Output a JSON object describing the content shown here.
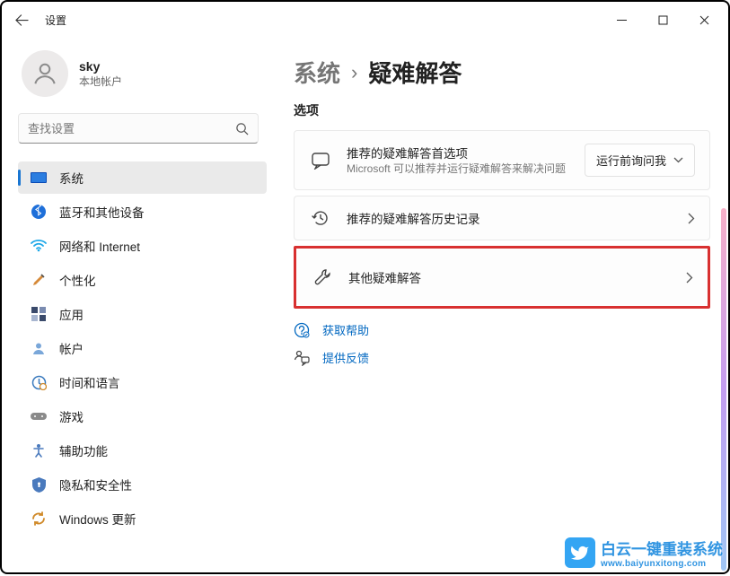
{
  "titlebar": {
    "app_name": "设置"
  },
  "user": {
    "name": "sky",
    "account": "本地帐户"
  },
  "search": {
    "placeholder": "查找设置"
  },
  "nav": {
    "items": [
      {
        "label": "系统"
      },
      {
        "label": "蓝牙和其他设备"
      },
      {
        "label": "网络和 Internet"
      },
      {
        "label": "个性化"
      },
      {
        "label": "应用"
      },
      {
        "label": "帐户"
      },
      {
        "label": "时间和语言"
      },
      {
        "label": "游戏"
      },
      {
        "label": "辅助功能"
      },
      {
        "label": "隐私和安全性"
      },
      {
        "label": "Windows 更新"
      }
    ]
  },
  "breadcrumb": {
    "parent": "系统",
    "sep": "›",
    "current": "疑难解答"
  },
  "section": {
    "options": "选项"
  },
  "cards": {
    "recommended": {
      "title": "推荐的疑难解答首选项",
      "subtitle": "Microsoft 可以推荐并运行疑难解答来解决问题",
      "dropdown": "运行前询问我"
    },
    "history": {
      "title": "推荐的疑难解答历史记录"
    },
    "other": {
      "title": "其他疑难解答"
    }
  },
  "links": {
    "help": "获取帮助",
    "feedback": "提供反馈"
  },
  "watermark": {
    "text": "白云一键重装系统",
    "url": "www.baiyunxitong.com"
  }
}
